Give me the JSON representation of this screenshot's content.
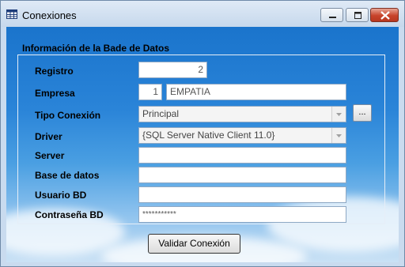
{
  "window": {
    "title": "Conexiones"
  },
  "form": {
    "group_label": "Información de la Bade de Datos",
    "labels": {
      "registro": "Registro",
      "empresa": "Empresa",
      "tipo_conexion": "Tipo Conexión",
      "driver": "Driver",
      "server": "Server",
      "base_datos": "Base de datos",
      "usuario": "Usuario BD",
      "password": "Contraseña BD"
    },
    "values": {
      "registro": "2",
      "empresa_id": "1",
      "empresa_name": "EMPATIA",
      "tipo_conexion": "Principal",
      "driver": "{SQL Server Native Client 11.0}",
      "server": "",
      "base_datos": "",
      "usuario": "",
      "password": "***********"
    },
    "ellipsis_label": "...",
    "validate_label": "Validar Conexión"
  },
  "icons": [
    "app-table-icon",
    "minimize-icon",
    "maximize-icon",
    "close-icon",
    "dropdown-arrow-icon"
  ]
}
